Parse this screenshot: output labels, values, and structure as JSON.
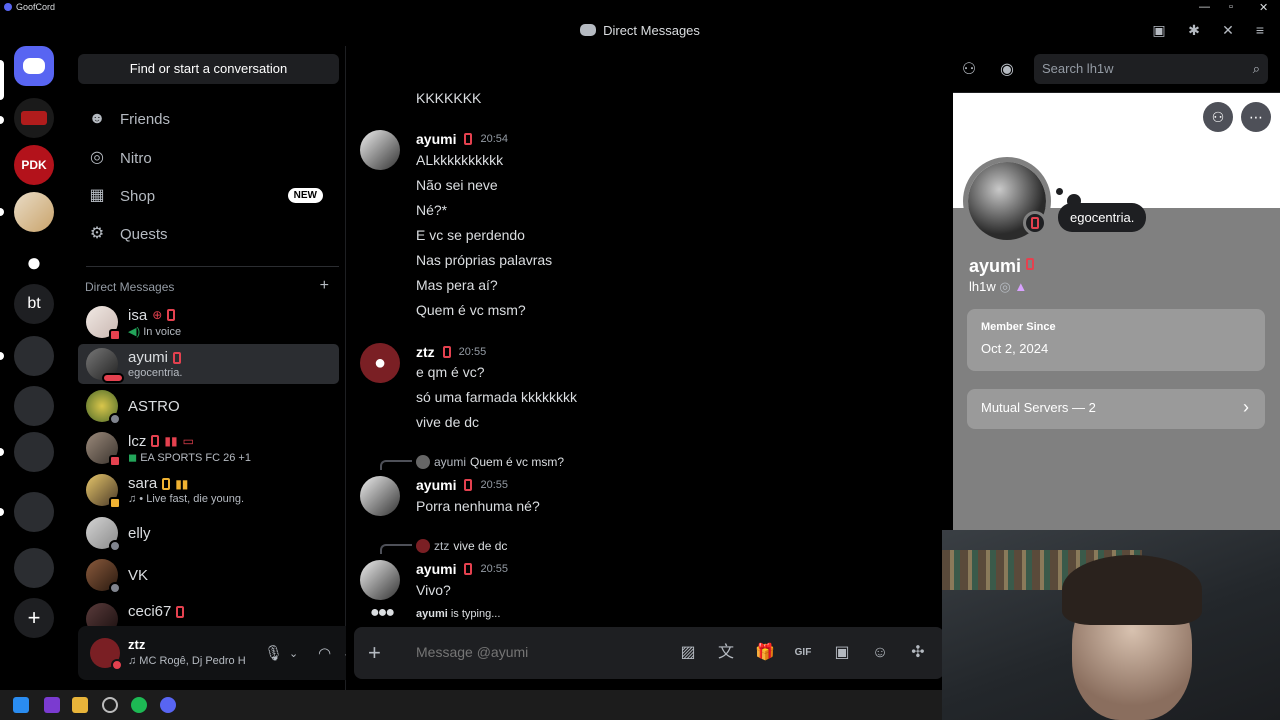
{
  "app": {
    "name": "GoofCord",
    "window_title": "Direct Messages"
  },
  "sidebar": {
    "find_label": "Find or start a conversation",
    "nav": [
      {
        "label": "Friends",
        "icon": "friends-icon"
      },
      {
        "label": "Nitro",
        "icon": "nitro-icon"
      },
      {
        "label": "Shop",
        "icon": "shop-icon",
        "badge": "NEW"
      },
      {
        "label": "Quests",
        "icon": "quests-icon"
      }
    ],
    "dm_header": "Direct Messages",
    "dms": [
      {
        "name": "isa",
        "sub": "In voice"
      },
      {
        "name": "ayumi",
        "sub": "egocentria."
      },
      {
        "name": "ASTRO",
        "sub": ""
      },
      {
        "name": "lcz",
        "sub": "EA SPORTS FC 26 +1"
      },
      {
        "name": "sara",
        "sub": "♫ • Live fast, die young."
      },
      {
        "name": "elly",
        "sub": ""
      },
      {
        "name": "VK",
        "sub": ""
      },
      {
        "name": "ceci67",
        "sub": ""
      }
    ]
  },
  "user_panel": {
    "name": "ztz",
    "activity": "♫ MC Rogê, Dj Pedro H"
  },
  "chat": {
    "recipient": "ayumi",
    "search_placeholder": "Search lh1w",
    "messages": {
      "top_line": "KKKKKKK",
      "m1": {
        "author": "ayumi",
        "time": "20:54",
        "lines": [
          "ALkkkkkkkkkk",
          "Não sei neve",
          "Né?*",
          "E vc se perdendo",
          "Nas próprias palavras",
          "Mas pera aí?",
          "Quem é vc msm?"
        ]
      },
      "m2": {
        "author": "ztz",
        "time": "20:55",
        "lines": [
          "e qm é vc?",
          "só uma farmada kkkkkkkk",
          "vive de dc"
        ]
      },
      "m3": {
        "reply_author": "ayumi",
        "reply_text": "Quem é vc msm?",
        "author": "ayumi",
        "time": "20:55",
        "lines": [
          "Porra nenhuma né?"
        ]
      },
      "m4": {
        "reply_author": "ztz",
        "reply_text": "vive de dc",
        "author": "ayumi",
        "time": "20:55",
        "lines": [
          "Vivo?"
        ]
      }
    },
    "typing_user": "ayumi",
    "typing_suffix": "is typing...",
    "composer_placeholder": "Message @ayumi"
  },
  "profile": {
    "status_bubble": "egocentria.",
    "display_name": "ayumi",
    "username": "lh1w",
    "member_since_label": "Member Since",
    "member_since": "Oct 2, 2024",
    "mutual_servers": "Mutual Servers — 2"
  },
  "guild_texts": {
    "pdk": "PDK",
    "bt": "bt"
  },
  "colors": {
    "brand": "#5865f2",
    "mobile_red": "#e4414f",
    "online": "#23a55a"
  }
}
